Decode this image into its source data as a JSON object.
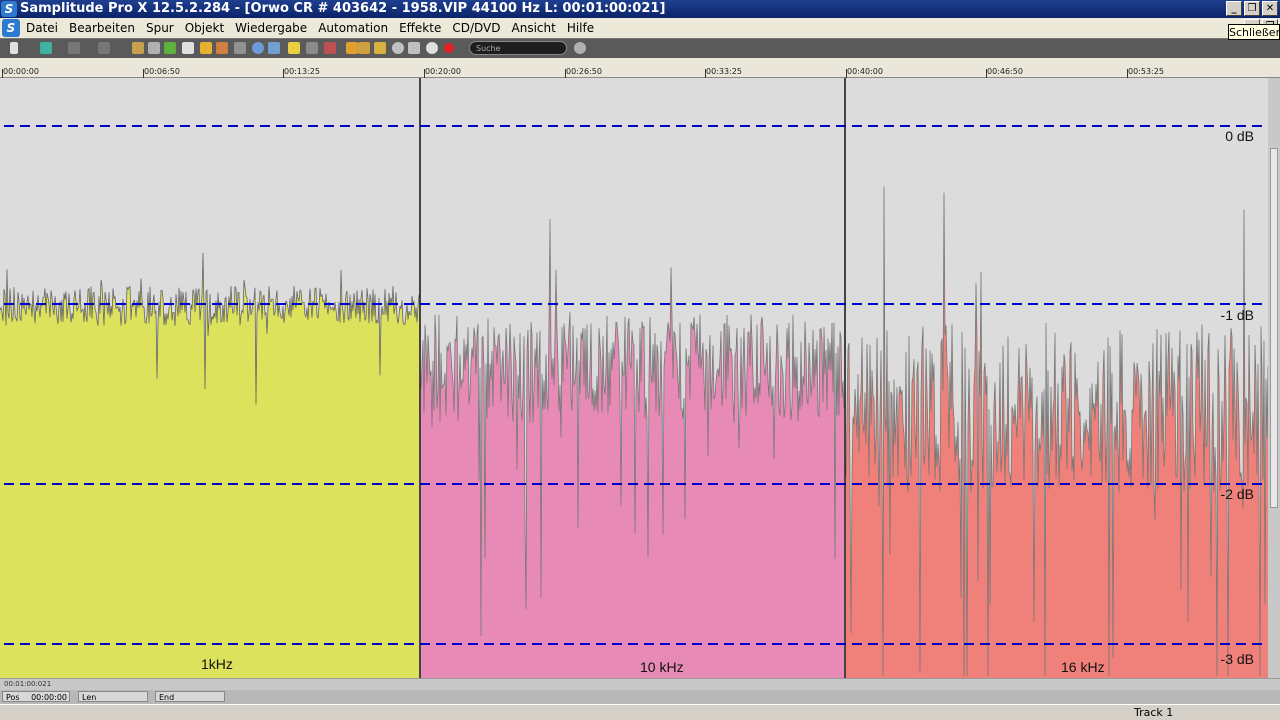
{
  "window": {
    "title": "Samplitude Pro X 12.5.2.284 - [Orwo CR # 403642 - 1958.VIP   44100 Hz L: 00:01:00:021]",
    "logo_letter": "S",
    "minimize_glyph": "_",
    "restore_glyph": "❐",
    "close_glyph": "✕"
  },
  "menu": {
    "items": [
      "Datei",
      "Bearbeiten",
      "Spur",
      "Objekt",
      "Wiedergabe",
      "Automation",
      "Effekte",
      "CD/DVD",
      "Ansicht",
      "Hilfe"
    ]
  },
  "tooltip": {
    "text": "Schließen"
  },
  "toolbar": {
    "search_placeholder": "Suche"
  },
  "ruler": {
    "labels": [
      "00:00:00",
      "00:06:50",
      "00:13:25",
      "00:20:00",
      "00:26:50",
      "00:33:25",
      "00:40:00",
      "00:46:50",
      "00:53:25"
    ]
  },
  "waveform": {
    "db_labels": [
      "0 dB",
      "-1 dB",
      "-2 dB",
      "-3 dB"
    ],
    "sections": [
      {
        "label": "1kHz",
        "color": "#dde25c"
      },
      {
        "label": "10 kHz",
        "color": "#e88ab6"
      },
      {
        "label": "16 kHz",
        "color": "#f0807a"
      }
    ],
    "guide_color": "#0000cc"
  },
  "hscroll": {
    "position_text": "00:01:00:021"
  },
  "status": {
    "pos_label": "Pos",
    "pos_value": "00:00:00",
    "len_label": "Len",
    "end_label": "End"
  },
  "bottom": {
    "track_label": "Track 1"
  }
}
